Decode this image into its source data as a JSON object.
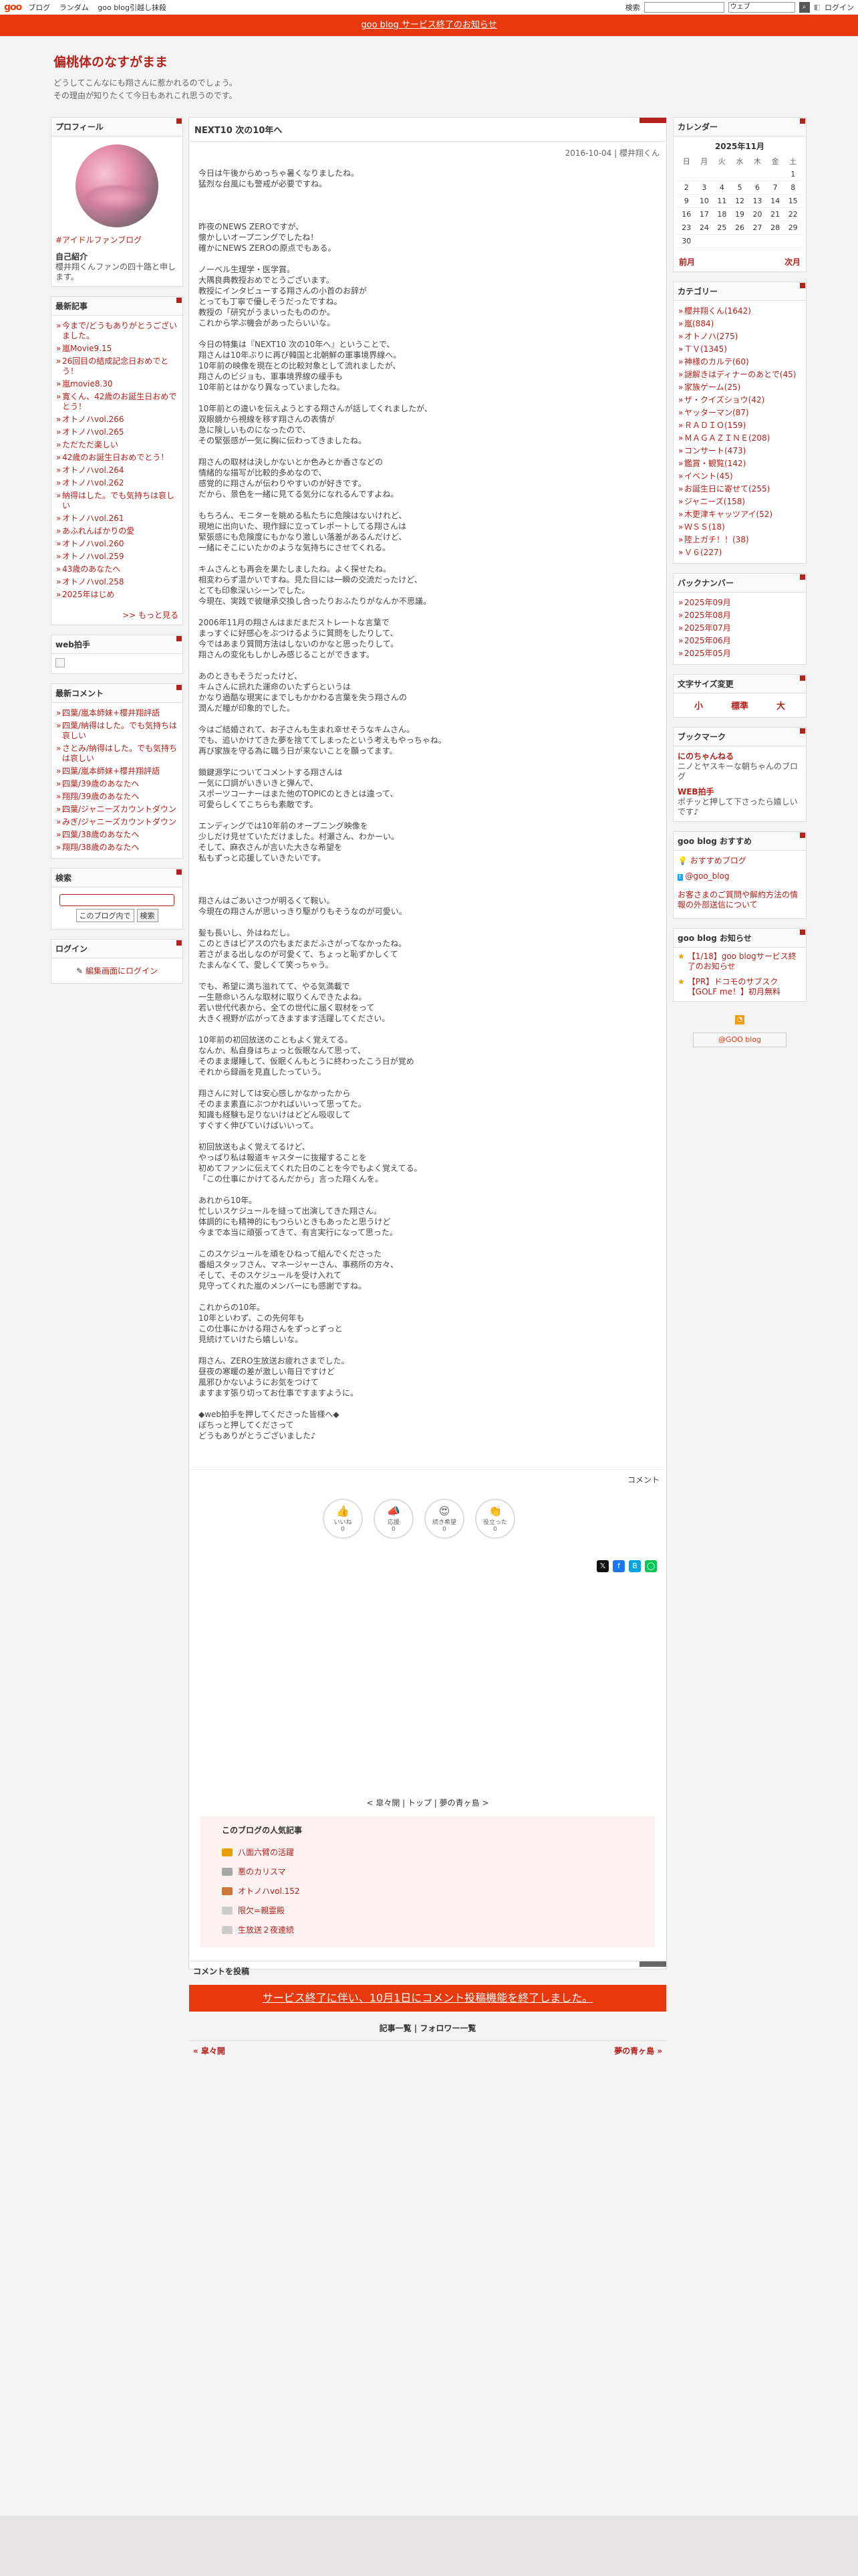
{
  "topbar": {
    "logo": "goo",
    "nav": [
      "ブログ",
      "ランダム",
      "goo blog引越し抹殺"
    ],
    "search_label": "検索",
    "search_mode": "ウェブ",
    "login": "ログイン"
  },
  "notice": "goo blog サービス終了のお知らせ",
  "blog": {
    "title": "偏桃体のなすがまま",
    "desc1": "どうしてこんなにも翔さんに惹かれるのでしょう。",
    "desc2": "その理由が知りたくて今日もあれこれ思うのです。"
  },
  "left": {
    "profile": {
      "title": "プロフィール",
      "link": "#アイドルファンブログ",
      "self_title": "自己紹介",
      "self": "櫻井翔くんファンの四十路と申します。"
    },
    "recent": {
      "title": "最新記事",
      "items": [
        "今まで/どうもありがとうございました。",
        "嵐Movie9.15",
        "26回目の結成記念日おめでとう！",
        "嵐movie8.30",
        "寛くん、42歳のお誕生日おめでとう！",
        "オトノハvol.266",
        "オトノハvol.265",
        "ただただ楽しい",
        "42歳のお誕生日おめでとう！",
        "オトノハvol.264",
        "オトノハvol.262",
        "納得はした。でも気持ちは哀しい",
        "オトノハvol.261",
        "あふれんばかりの愛",
        "オトノハvol.260",
        "オトノハvol.259",
        "43歳のあなたへ",
        "オトノハvol.258",
        "2025年はじめ"
      ],
      "more": ">> もっと見る"
    },
    "webclap": {
      "title": "web拍手"
    },
    "comments": {
      "title": "最新コメント",
      "items": [
        "四葉/嵐本師妹+櫻井翔評語",
        "四葉/納得はした。でも気持ちは哀しい",
        "さとみ/納得はした。でも気持ちは哀しい",
        "四葉/嵐本師妹+櫻井翔評語",
        "四葉/39歳のあなたへ",
        "翔翔/39歳のあなたへ",
        "四葉/ジャニーズカウントダウン",
        "みぎ/ジャニーズカウントダウン",
        "四葉/38歳のあなたへ",
        "翔翔/38歳のあなたへ"
      ]
    },
    "search": {
      "title": "検索",
      "scope": "このブログ内で",
      "btn": "検索"
    },
    "login": {
      "title": "ログイン",
      "link": "編集画面にログイン"
    }
  },
  "entry": {
    "title": "NEXT10 次の10年へ",
    "date": "2016-10-04 | 櫻井翔くん",
    "paras": [
      "今日は午後からめっちゃ暑くなりましたね。\n猛烈な台風にも警戒が必要ですね。",
      "",
      "昨夜のNEWS ZEROですが、\n懐かしいオープニングでしたね！\n確かにNEWS ZEROの原点でもある。",
      "ノーベル生理学・医学賞。\n大隅良典教授おめでとうございます。\n教授にインタビューする翔さんの小首のお辞が\nとっても丁寧で優しそうだったですね。\n教授の「研究がうまいったもののか。\nこれから学ぶ機会があったらいいな。",
      "今日の特集は『NEXT10 次の10年へ』ということで、\n翔さんは10年ぶりに再び韓国と北朝鮮の軍事境界線へ。\n10年前の映像を現在との比較対象として流れましたが、\n翔さんのビジョも、軍事境界線の緩手も\n10年前とはかなり異なっていましたね。",
      "10年前との違いを伝えようとする翔さんが話してくれましたが、\n双眼鏡から視線を移す翔さんの表情が\n急に険しいものになったので、\nその緊張感が一気に胸に伝わってきましたね。",
      "翔さんの取材は決しかないとか色みとか香さなどの\n情緒的な描写が比較的多めなので、\n感覚的に翔さんが伝わりやすいのが好きです。\nだから、景色を一緒に見てる気分になれるんですよね。",
      "もちろん、モニターを眺める私たちに危険はないけれど、\n現地に出向いた、現作録に立ってレポートしてる翔さんは\n緊張感にも危険度にもかなり激しい落差があるんだけど、\n一緒にそこにいたかのような気持ちにさせてくれる。",
      "キムさんとも再会を果たしましたね。よく探せたね。\n相変わらず温かいですね。見た目には一瞬の交流だったけど、\nとても印象深いシーンでした。\n今現在、実践で彼継承交換し合ったりおふたりがなんか不思議。",
      "2006年11月の翔さんはまだまだストレートな言葉で\nまっすぐに好感心をぶつけるように質問をしたりして、\n今ではあまり質問方法はしないのかなと思ったりして。\n翔さんの変化もしかしみ感じることができます。",
      "あのときもそうだったけど、\nキムさんに訊れた運命のいたずらというは\nかなり過酷な現実にまでしもかかわる言葉を失う翔さんの\n潤んだ瞳が印象的でした。",
      "今はご結婚されて、お子さんも生まれ幸せそうなキムさん。\nでも、追いかけてきた夢を捨ててしまったという考えもやっちゃね。\n再び家族を守る為に職う日が来ないことを願ってます。",
      "鎖鍵源学についてコメントする翔さんは\n一気に口調がいきいきと弾んで、\nスポーツコーナーはまた他のTOPICのときとは違って、\n可愛らしくてこちらも素敵です。",
      "エンディングでは10年前のオープニング映像を\n少しだけ見せていただけました。村瀬さん、わかーい。\nそして、麻衣さんが言いた大きな希望を\n私もずっと応援していきたいです。",
      "",
      "翔さんはごあいさつが明るくて鞍い。\n今現在の翔さんが思いっきり駆がりもそうなのが可愛い。",
      "髪も長いし、外はねだし。\nこのときはピアスの穴もまだまだふさがってなかったね。\n若さがまる出しなのが可愛くて、ちょっと恥ずかしくて\nたまんなくて、愛しくて笑っちゃう。",
      "でも、希望に満ち溢れてて、やる気満載で\n一生懸命いろんな取材に取りくんできたよね。\n若い世代代表から、全ての世代に届く取材をって\n大きく視野が広がってきますます活躍してください。",
      "10年前の初回放送のこともよく覚えてる。\nなんか、私自身はちょっと仮眠なんて思って、\nそのまま爆睡して、仮眠くんもとうに終わったこう日が覚め\nそれから録画を見直したっていう。",
      "翔さんに対しては安心感しかなかったから\nそのまま素直にぶつかればいいって思ってた。\n知識も経験も足りないけはどどん吸収して\nすぐすく伸びていけばいいって。",
      "初回放送もよく覚えてるけど、\nやっぱり私は報道キャスターに抜擢することを\n初めてファンに伝えてくれた日のことを今でもよく覚えてる。\n「この仕事にかけてるんだから」言った翔くんを。",
      "あれから10年。\n忙しいスケジュールを縫って出演してきた翔さん。\n体調的にも精神的にもつらいときもあったと思うけど\n今まで本当に頑張ってきて、有言実行になって思った。",
      "このスケジュールを頑をひねって組んでくださった\n番組スタッフさん、マネージャーさん、事務所の方々、\nそして、そのスケジュールを受け入れて\n見守ってくれた嵐のメンバーにも感謝ですね。",
      "これからの10年。\n10年といわず、この先何年も\nこの仕事にかける翔さんをずっとずっと\n見続けていけたら嬉しいな。",
      "翔さん、ZERO生放送お疲れさまでした。\n昼夜の寒暖の差が激しい毎日ですけど\n風邪ひかないようにお気をつけて\nますます張り切ってお仕事ですますように。",
      "◆web拍手を押してくださった皆様へ◆\nぽちっと押してくださって\nどうもありがとうございました♪"
    ],
    "comment_link": "コメント",
    "reactions": [
      {
        "ico": "👍",
        "label": "いいね",
        "count": "0"
      },
      {
        "ico": "📣",
        "label": "応援",
        "count": "0"
      },
      {
        "ico": "😍",
        "label": "続き希望",
        "count": "0"
      },
      {
        "ico": "👏",
        "label": "役立った",
        "count": "0"
      }
    ],
    "nav": "< 皐々開 | トップ | 夢の青ヶ島 >",
    "popular_title": "このブログの人気記事",
    "popular": [
      "八面六臂の活躍",
      "悪のカリスマ",
      "オトノハvol.152",
      "限欠=親霊殿",
      "生放送２夜連続"
    ],
    "comment_post": "コメントを投稿",
    "comment_notice": "サービス終了に伴い、10月1日にコメント投稿機能を終了しました。",
    "list_links": "記事一覧 | フォロワー一覧",
    "prev": "« 皐々開",
    "next": "夢の青ヶ島 »"
  },
  "right": {
    "calendar": {
      "title": "カレンダー",
      "month": "2025年11月",
      "wd": [
        "日",
        "月",
        "火",
        "水",
        "木",
        "金",
        "土"
      ],
      "weeks": [
        [
          "",
          "",
          "",
          "",
          "",
          "",
          "1"
        ],
        [
          "2",
          "3",
          "4",
          "5",
          "6",
          "7",
          "8"
        ],
        [
          "9",
          "10",
          "11",
          "12",
          "13",
          "14",
          "15"
        ],
        [
          "16",
          "17",
          "18",
          "19",
          "20",
          "21",
          "22"
        ],
        [
          "23",
          "24",
          "25",
          "26",
          "27",
          "28",
          "29"
        ],
        [
          "30",
          "",
          "",
          "",
          "",
          "",
          ""
        ]
      ],
      "prev": "前月",
      "next": "次月"
    },
    "category": {
      "title": "カテゴリー",
      "items": [
        "櫻井翔くん(1642)",
        "嵐(884)",
        "オトノハ(275)",
        "ＴＶ(1345)",
        "神様のカルテ(60)",
        "謎解きはディナーのあとで(45)",
        "家族ゲーム(25)",
        "ザ・クイズショウ(42)",
        "ヤッターマン(87)",
        "ＲＡＤＩＯ(159)",
        "ＭＡＧＡＺＩＮＥ(208)",
        "コンサート(473)",
        "鑑賞・観覧(142)",
        "イベント(45)",
        "お誕生日に寄せて(255)",
        "ジャニーズ(158)",
        "木更津キャッツアイ(52)",
        "ＷＳＳ(18)",
        "陸上ガチ！！(38)",
        "Ｖ６(227)"
      ]
    },
    "backnumber": {
      "title": "バックナンバー",
      "items": [
        "2025年09月",
        "2025年08月",
        "2025年07月",
        "2025年06月",
        "2025年05月"
      ]
    },
    "fontsize": {
      "title": "文字サイズ変更",
      "small": "小",
      "medium": "標準",
      "large": "大"
    },
    "bookmark": {
      "title": "ブックマーク",
      "items": [
        {
          "t": "にのちゃんねる",
          "d": "ニノとヤスキーな朝ちゃんのブログ"
        },
        {
          "t": "WEB拍手",
          "d": "ポチッと押して下さったら嬉しいです♪"
        }
      ]
    },
    "goo_recommend": {
      "title": "goo blog おすすめ",
      "items": [
        "おすすめブログ",
        "@goo_blog"
      ],
      "inquiry": "お客さまのご質問や解約方法の情報の外部送信について"
    },
    "goo_info": {
      "title": "goo blog お知らせ",
      "items": [
        "【1/18】goo blogサービス終了のお知らせ",
        "【PR】ドコモのサブスク【GOLF me！】初月無料"
      ]
    },
    "goo_btn": "@GOO blog"
  }
}
